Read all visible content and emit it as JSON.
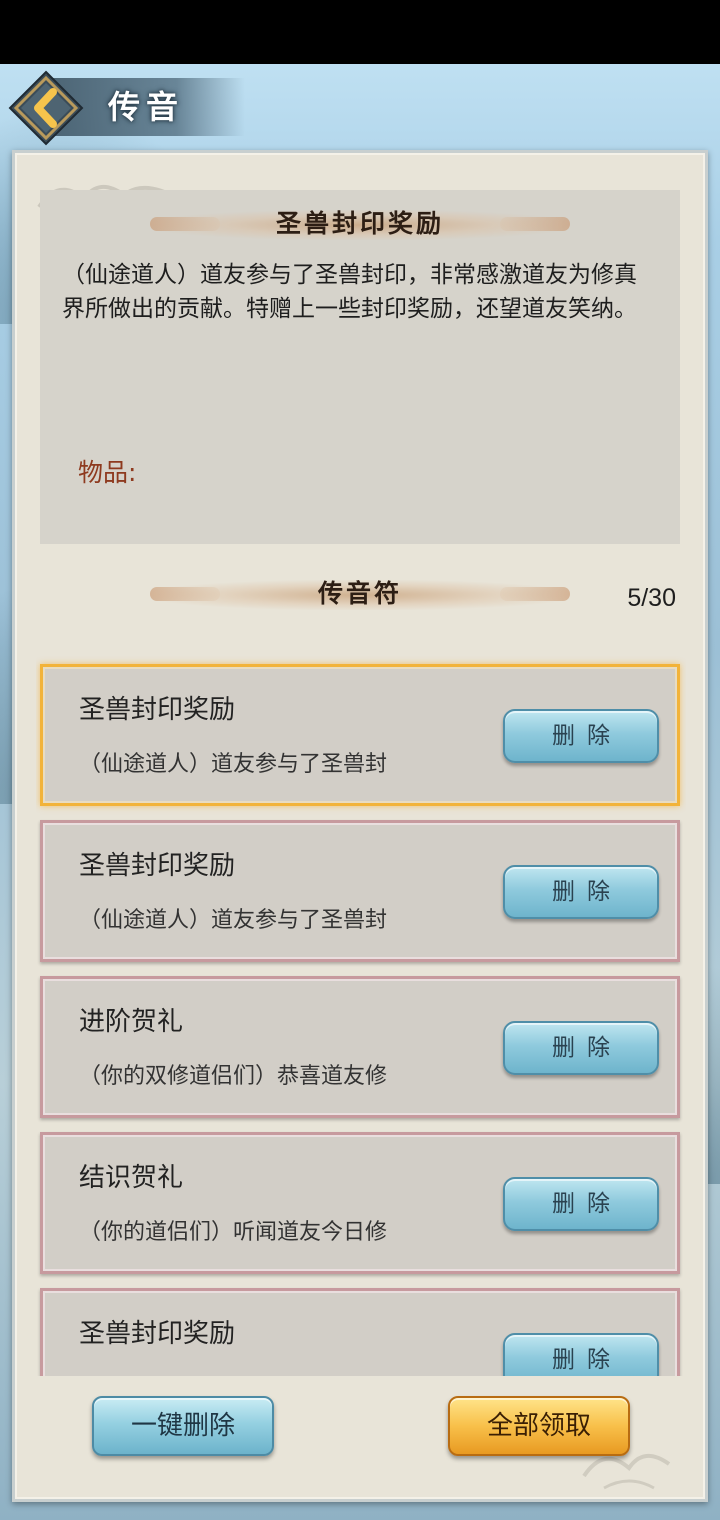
{
  "header": {
    "title": "传音",
    "back_icon": "chevron-left-icon"
  },
  "detail": {
    "title": "圣兽封印奖励",
    "body": "（仙途道人）道友参与了圣兽封印，非常感激道友为修真界所做出的贡献。特赠上一些封印奖励，还望道友笑纳。",
    "items_label": "物品:"
  },
  "list_section": {
    "title": "传音符",
    "count": "5/30"
  },
  "mails": [
    {
      "title": "圣兽封印奖励",
      "preview": "（仙途道人）道友参与了圣兽封",
      "delete_label": "删除",
      "selected": true
    },
    {
      "title": "圣兽封印奖励",
      "preview": "（仙途道人）道友参与了圣兽封",
      "delete_label": "删除",
      "selected": false
    },
    {
      "title": "进阶贺礼",
      "preview": "（你的双修道侣们）恭喜道友修",
      "delete_label": "删除",
      "selected": false
    },
    {
      "title": "结识贺礼",
      "preview": "（你的道侣们）听闻道友今日修",
      "delete_label": "删除",
      "selected": false
    },
    {
      "title": "圣兽封印奖励",
      "preview": "",
      "delete_label": "删除",
      "selected": false
    }
  ],
  "footer": {
    "delete_all_label": "一键删除",
    "claim_all_label": "全部领取"
  },
  "colors": {
    "accent_gold": "#f2b33a",
    "item_border": "#c79a9e",
    "items_label_color": "#8e3a1f",
    "delete_button_blue": "#8fcadd"
  }
}
